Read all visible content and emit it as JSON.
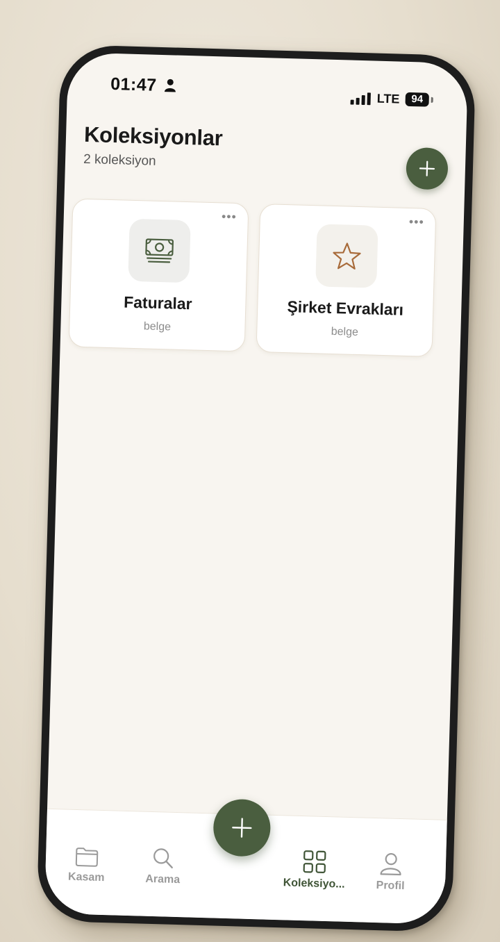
{
  "status_bar": {
    "time": "01:47",
    "network": "LTE",
    "battery": "94"
  },
  "header": {
    "title": "Koleksiyonlar",
    "subtitle": "2 koleksiyon"
  },
  "collections": [
    {
      "name": "Faturalar",
      "count_label": "belge",
      "icon": "money-icon",
      "icon_color": "#4a5e3f"
    },
    {
      "name": "Şirket Evrakları",
      "count_label": "belge",
      "icon": "star-icon",
      "icon_color": "#a86b3a"
    }
  ],
  "more_label": "•••",
  "tab_bar": {
    "items": [
      {
        "label": "Kasam",
        "icon": "folder-icon"
      },
      {
        "label": "Arama",
        "icon": "search-icon"
      },
      {
        "label": "Koleksiyo...",
        "icon": "grid-icon",
        "active": true
      },
      {
        "label": "Profil",
        "icon": "person-icon"
      }
    ]
  },
  "colors": {
    "accent": "#4a5e3f",
    "background": "#f8f5f0",
    "star": "#a86b3a"
  }
}
